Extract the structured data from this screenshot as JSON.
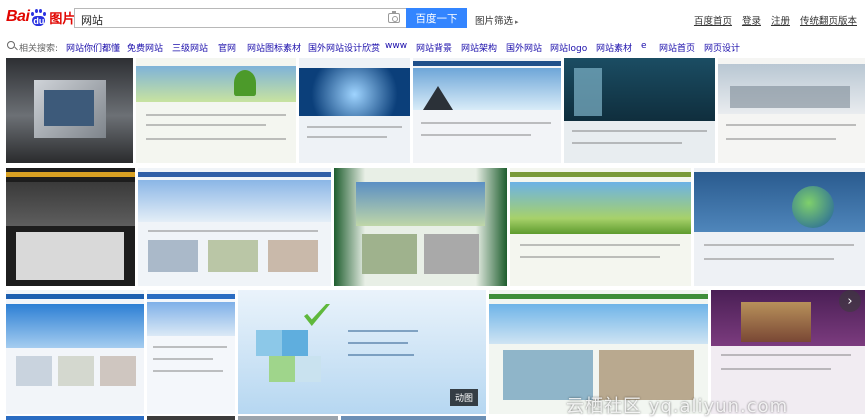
{
  "header": {
    "logo_bai": "Bai",
    "logo_du": "du",
    "logo_cn": "图片",
    "search_query": "网站",
    "search_button": "百度一下",
    "filter_label": "图片筛选",
    "top_links": [
      "百度首页",
      "登录",
      "注册",
      "传统翻页版本"
    ]
  },
  "related": {
    "label": "相关搜索:",
    "items": [
      "网站你们都懂",
      "免费网站",
      "三级网站",
      "官网",
      "网站图标素材",
      "国外网站设计欣赏",
      "www",
      "网站背景",
      "网站架构",
      "国外网站",
      "网站logo",
      "网站素材",
      "e",
      "网站首页",
      "网页设计"
    ]
  },
  "grid": {
    "badge": "动图",
    "watermark": "云栖社区 yq.aliyun.com"
  },
  "colors": {
    "brand_red": "#e10602",
    "brand_blue": "#2932e1",
    "button_blue": "#3385ff",
    "link_blue": "#1a0dab"
  }
}
